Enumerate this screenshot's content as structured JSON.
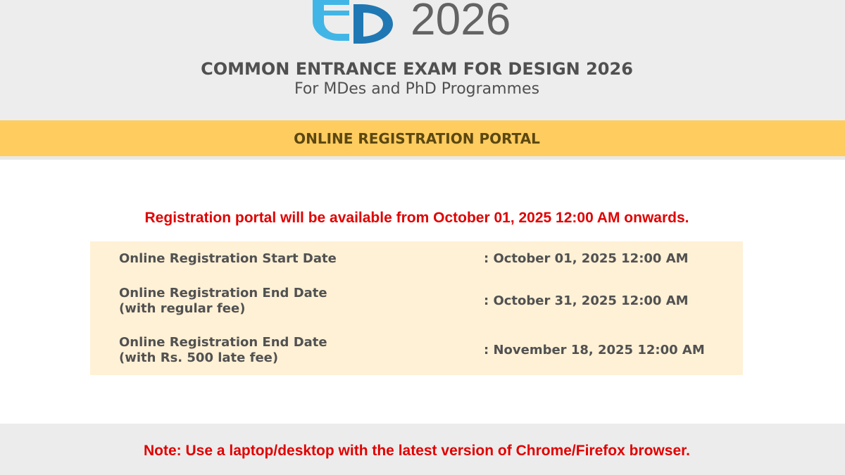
{
  "header": {
    "logo_year": "2026",
    "title": "COMMON ENTRANCE EXAM FOR DESIGN 2026",
    "subtitle": "For MDes and PhD Programmes",
    "logo_colors": {
      "light_blue": "#41b6e6",
      "dark_blue": "#1f78b4"
    }
  },
  "portal": {
    "title": "ONLINE REGISTRATION PORTAL",
    "accent_color": "#fecc5f"
  },
  "notice": "Registration portal will be available from October 01, 2025 12:00 AM onwards.",
  "dates": [
    {
      "label_line1": "Online Registration Start Date",
      "label_line2": "",
      "value": ": October 01, 2025 12:00 AM"
    },
    {
      "label_line1": "Online Registration End Date",
      "label_line2": "(with regular fee)",
      "value": ": October 31, 2025 12:00 AM"
    },
    {
      "label_line1": "Online Registration End Date",
      "label_line2": "(with Rs. 500 late fee)",
      "value": ": November 18, 2025 12:00 AM"
    }
  ],
  "footer": {
    "note": "Note: Use a laptop/desktop with the latest version of Chrome/Firefox browser."
  }
}
